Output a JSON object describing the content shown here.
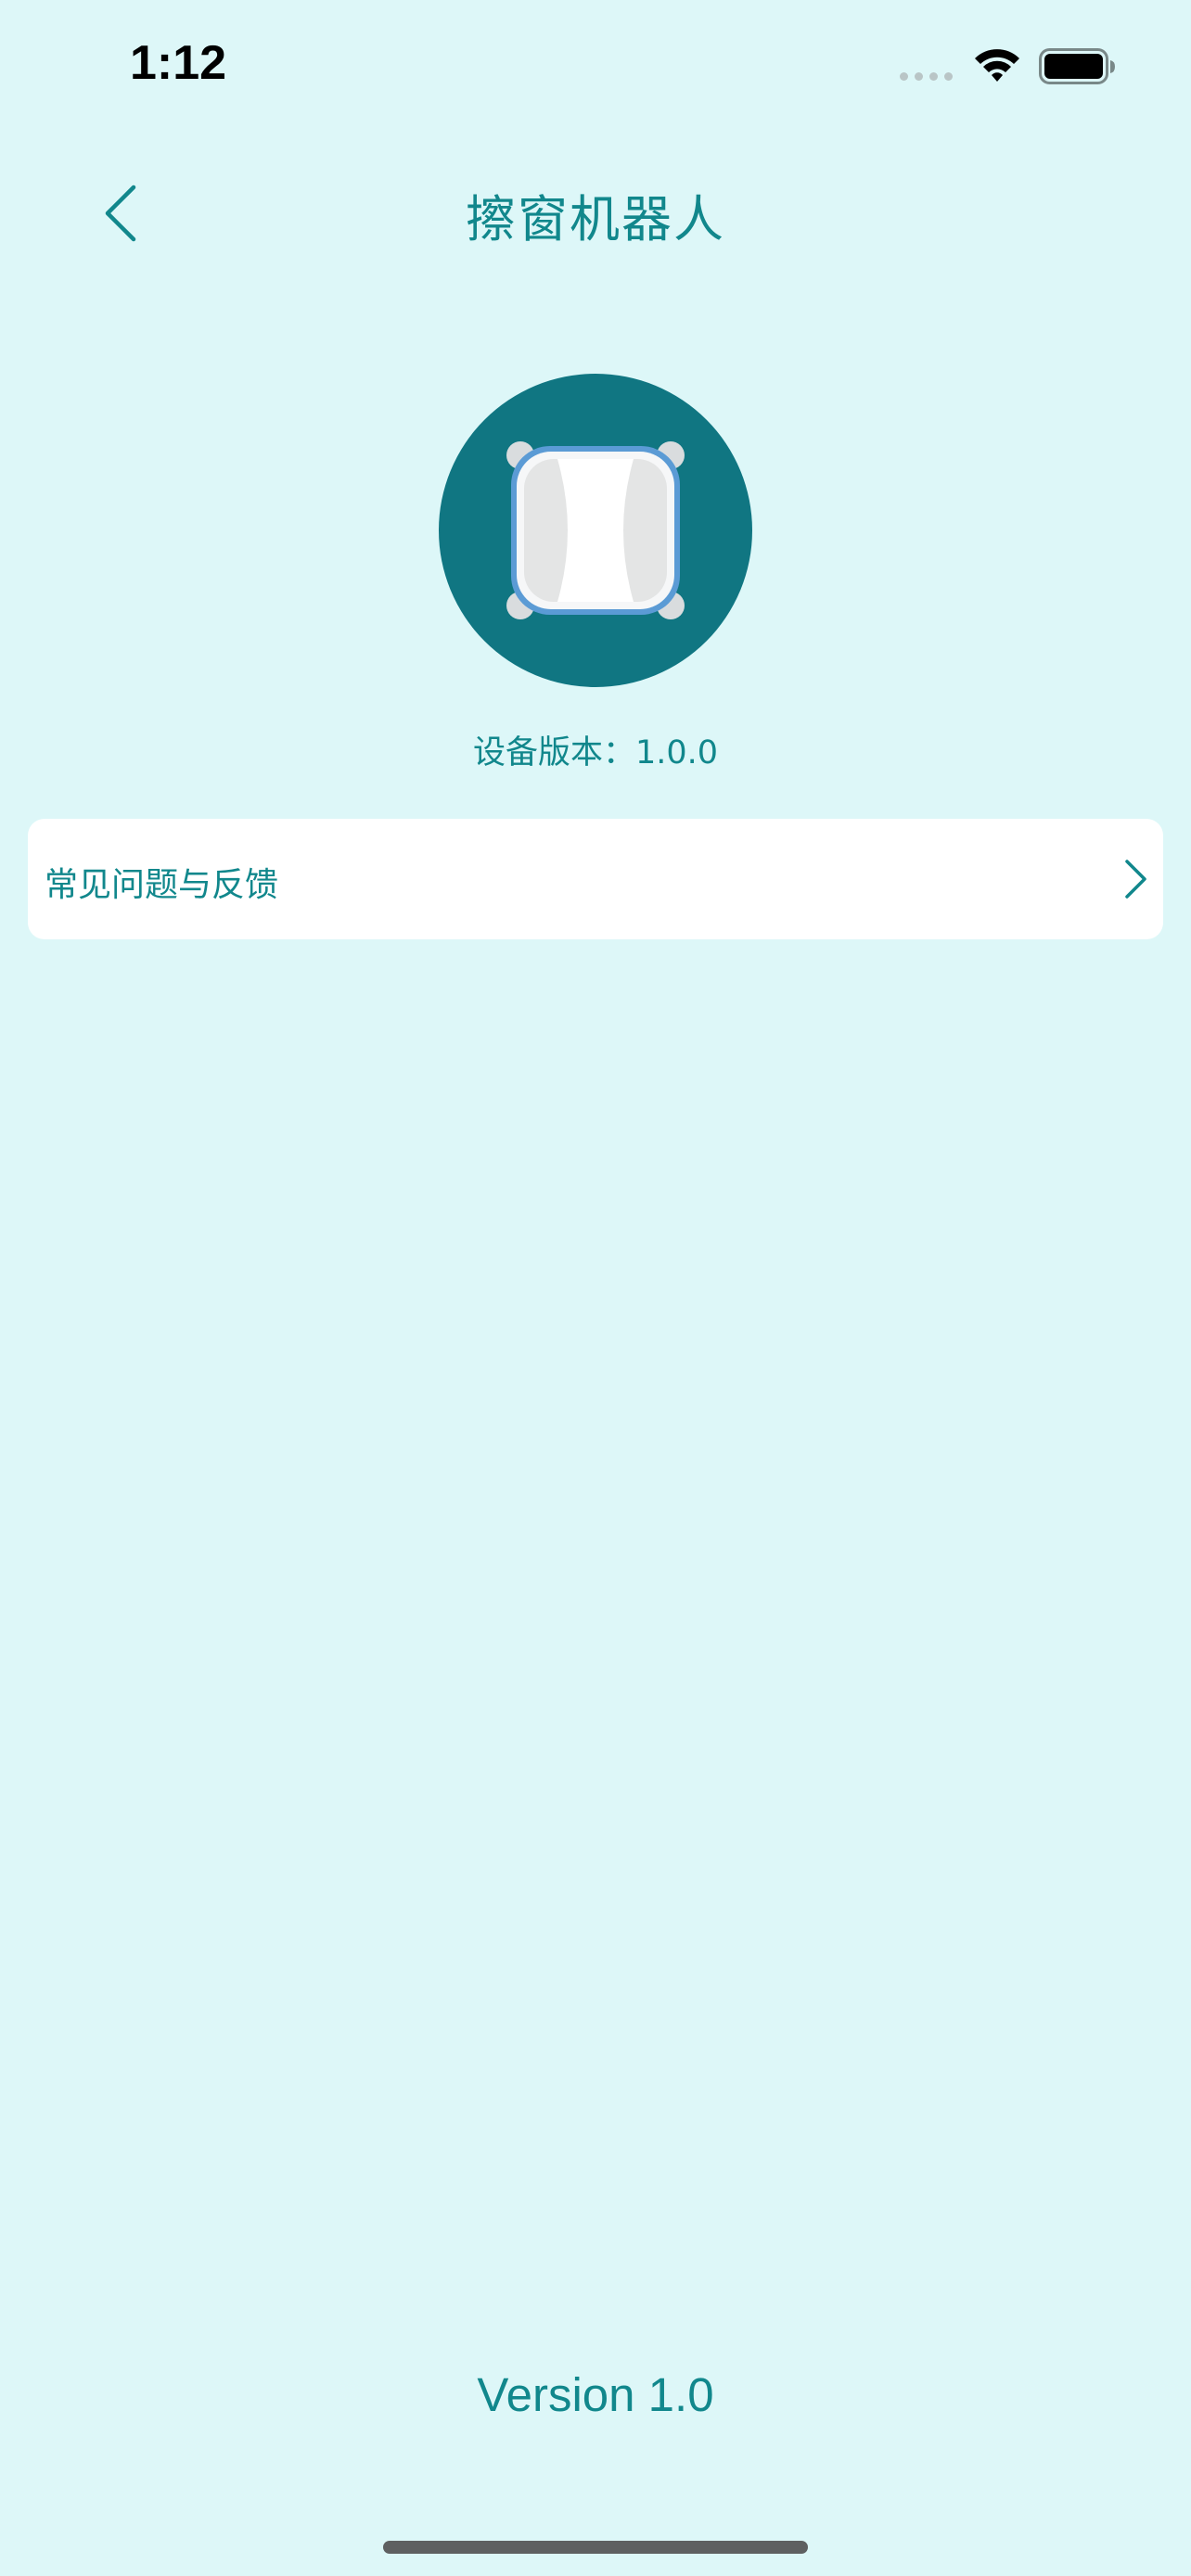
{
  "status_bar": {
    "time": "1:12"
  },
  "nav": {
    "title": "擦窗机器人"
  },
  "device": {
    "version_text": "设备版本：1.0.0"
  },
  "menu": {
    "items": [
      {
        "label": "常见问题与反馈"
      }
    ]
  },
  "footer": {
    "app_version": "Version 1.0"
  },
  "colors": {
    "background": "#ddf7f8",
    "accent": "#11878c",
    "device_circle": "#107682"
  },
  "icons": [
    "back-chevron-icon",
    "wifi-icon",
    "battery-icon",
    "chevron-right-icon"
  ]
}
